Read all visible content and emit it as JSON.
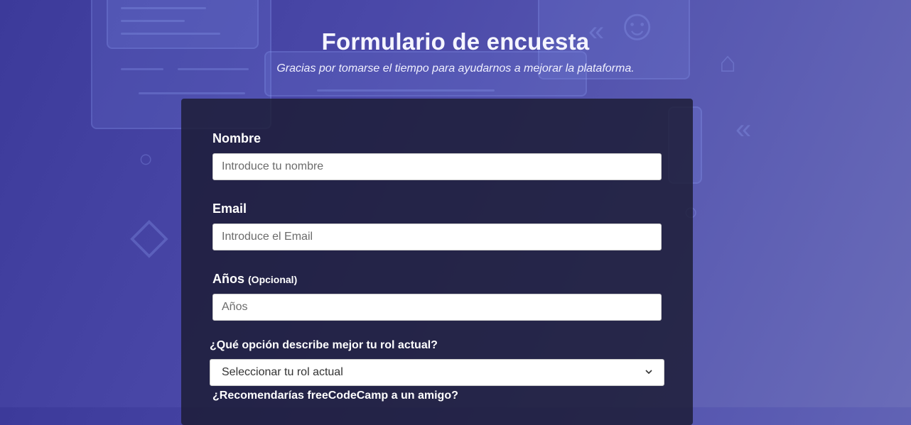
{
  "header": {
    "title": "Formulario de encuesta",
    "description": "Gracias por tomarse el tiempo para ayudarnos a mejorar la plataforma."
  },
  "form": {
    "name": {
      "label": "Nombre",
      "placeholder": "Introduce tu nombre"
    },
    "email": {
      "label": "Email",
      "placeholder": "Introduce el Email"
    },
    "age": {
      "label": "Años",
      "optional": "(Opcional)",
      "placeholder": "Años"
    },
    "role": {
      "label": "¿Qué opción describe mejor tu rol actual?",
      "selected": "Seleccionar tu rol actual"
    },
    "recommend": {
      "label": "¿Recomendarías freeCodeCamp a un amigo?"
    }
  },
  "colors": {
    "background_start": "#3c3a9a",
    "background_end": "#6a6cb8",
    "card": "#1b1b32"
  }
}
